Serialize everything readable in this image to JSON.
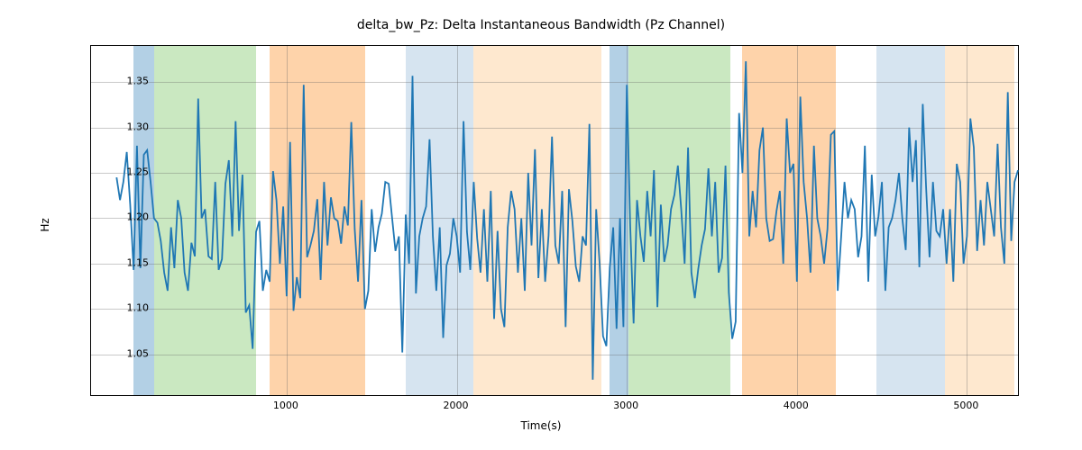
{
  "chart_data": {
    "type": "line",
    "title": "delta_bw_Pz: Delta Instantaneous Bandwidth (Pz Channel)",
    "xlabel": "Time(s)",
    "ylabel": "Hz",
    "xlim": [
      -150,
      5300
    ],
    "ylim": [
      1.005,
      1.39
    ],
    "xticks": [
      1000,
      2000,
      3000,
      4000,
      5000
    ],
    "yticks": [
      1.05,
      1.1,
      1.15,
      1.2,
      1.25,
      1.3,
      1.35
    ],
    "bg_spans": [
      {
        "x0": 100,
        "x1": 220,
        "color": "rgba(128,177,211,0.6)"
      },
      {
        "x0": 220,
        "x1": 820,
        "color": "rgba(179,222,166,0.7)"
      },
      {
        "x0": 900,
        "x1": 1460,
        "color": "rgba(253,192,134,0.7)"
      },
      {
        "x0": 1700,
        "x1": 2100,
        "color": "rgba(197,216,233,0.7)"
      },
      {
        "x0": 2100,
        "x1": 2850,
        "color": "rgba(253,222,186,0.7)"
      },
      {
        "x0": 2900,
        "x1": 3010,
        "color": "rgba(128,177,211,0.6)"
      },
      {
        "x0": 3010,
        "x1": 3610,
        "color": "rgba(179,222,166,0.7)"
      },
      {
        "x0": 3680,
        "x1": 4230,
        "color": "rgba(253,192,134,0.7)"
      },
      {
        "x0": 4470,
        "x1": 4870,
        "color": "rgba(197,216,233,0.7)"
      },
      {
        "x0": 4870,
        "x1": 5280,
        "color": "rgba(253,222,186,0.7)"
      }
    ],
    "series": [
      {
        "name": "delta_bw_Pz",
        "x_start": 0,
        "x_step": 20,
        "y": [
          1.245,
          1.22,
          1.24,
          1.273,
          1.215,
          1.143,
          1.28,
          1.145,
          1.27,
          1.275,
          1.24,
          1.2,
          1.195,
          1.175,
          1.14,
          1.12,
          1.19,
          1.145,
          1.22,
          1.2,
          1.14,
          1.12,
          1.173,
          1.158,
          1.332,
          1.2,
          1.21,
          1.158,
          1.155,
          1.24,
          1.143,
          1.155,
          1.238,
          1.264,
          1.18,
          1.307,
          1.186,
          1.248,
          1.096,
          1.104,
          1.056,
          1.185,
          1.197,
          1.12,
          1.143,
          1.13,
          1.252,
          1.22,
          1.15,
          1.213,
          1.114,
          1.284,
          1.098,
          1.135,
          1.112,
          1.347,
          1.157,
          1.17,
          1.186,
          1.221,
          1.132,
          1.24,
          1.17,
          1.223,
          1.2,
          1.197,
          1.172,
          1.213,
          1.192,
          1.306,
          1.188,
          1.13,
          1.22,
          1.1,
          1.12,
          1.21,
          1.163,
          1.19,
          1.205,
          1.24,
          1.238,
          1.2,
          1.164,
          1.18,
          1.052,
          1.204,
          1.15,
          1.357,
          1.117,
          1.18,
          1.2,
          1.213,
          1.287,
          1.18,
          1.12,
          1.19,
          1.068,
          1.148,
          1.161,
          1.2,
          1.18,
          1.14,
          1.307,
          1.185,
          1.143,
          1.24,
          1.178,
          1.14,
          1.21,
          1.13,
          1.23,
          1.089,
          1.186,
          1.1,
          1.08,
          1.19,
          1.23,
          1.21,
          1.14,
          1.2,
          1.12,
          1.25,
          1.17,
          1.276,
          1.134,
          1.21,
          1.13,
          1.181,
          1.29,
          1.17,
          1.15,
          1.23,
          1.08,
          1.232,
          1.197,
          1.147,
          1.13,
          1.18,
          1.17,
          1.304,
          1.022,
          1.21,
          1.15,
          1.07,
          1.059,
          1.146,
          1.19,
          1.078,
          1.2,
          1.08,
          1.347,
          1.193,
          1.084,
          1.22,
          1.18,
          1.152,
          1.23,
          1.18,
          1.253,
          1.102,
          1.215,
          1.152,
          1.17,
          1.21,
          1.226,
          1.258,
          1.21,
          1.15,
          1.278,
          1.14,
          1.112,
          1.144,
          1.17,
          1.188,
          1.255,
          1.18,
          1.24,
          1.14,
          1.156,
          1.258,
          1.118,
          1.067,
          1.086,
          1.316,
          1.25,
          1.373,
          1.18,
          1.23,
          1.19,
          1.275,
          1.3,
          1.2,
          1.175,
          1.177,
          1.208,
          1.23,
          1.15,
          1.31,
          1.25,
          1.26,
          1.13,
          1.334,
          1.24,
          1.2,
          1.14,
          1.28,
          1.2,
          1.18,
          1.15,
          1.188,
          1.292,
          1.296,
          1.12,
          1.178,
          1.24,
          1.2,
          1.22,
          1.21,
          1.157,
          1.18,
          1.28,
          1.13,
          1.248,
          1.18,
          1.202,
          1.24,
          1.12,
          1.19,
          1.2,
          1.22,
          1.25,
          1.2,
          1.165,
          1.3,
          1.24,
          1.286,
          1.146,
          1.326,
          1.234,
          1.157,
          1.24,
          1.186,
          1.18,
          1.21,
          1.15,
          1.21,
          1.13,
          1.26,
          1.24,
          1.15,
          1.18,
          1.31,
          1.278,
          1.164,
          1.22,
          1.17,
          1.24,
          1.21,
          1.18,
          1.282,
          1.19,
          1.15,
          1.339,
          1.175,
          1.24,
          1.253
        ]
      }
    ]
  }
}
